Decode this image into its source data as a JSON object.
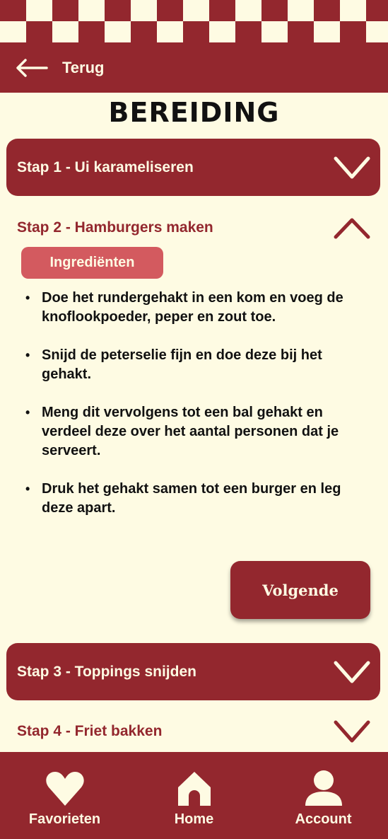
{
  "header": {
    "back_label": "Terug"
  },
  "page_title": "BEREIDING",
  "steps": [
    {
      "label": "Stap 1 - Ui karameliseren"
    },
    {
      "label": "Stap 2 - Hamburgers maken"
    },
    {
      "label": "Stap 3 - Toppings snijden"
    },
    {
      "label": "Stap 4 - Friet bakken"
    }
  ],
  "step2": {
    "ingredients_label": "Ingrediënten",
    "instructions": [
      "Doe het rundergehakt in een kom en voeg de knoflookpoeder, peper en zout toe.",
      "Snijd de peterselie fijn en doe deze bij het gehakt.",
      "Meng dit vervolgens tot een bal gehakt en verdeel deze over het aantal personen dat je serveert.",
      "Druk het gehakt samen tot een burger en leg deze apart."
    ],
    "next_label": "Volgende"
  },
  "nav": {
    "favorites_label": "Favorieten",
    "home_label": "Home",
    "account_label": "Account"
  },
  "icons": {
    "back": "arrow-left-icon",
    "expand": "chevron-down-icon",
    "collapse": "chevron-up-icon",
    "favorites": "heart-icon",
    "home": "house-icon",
    "account": "person-icon"
  },
  "colors": {
    "primary": "#93272E",
    "background": "#FEFBE3",
    "accent": "#D35A5F"
  }
}
